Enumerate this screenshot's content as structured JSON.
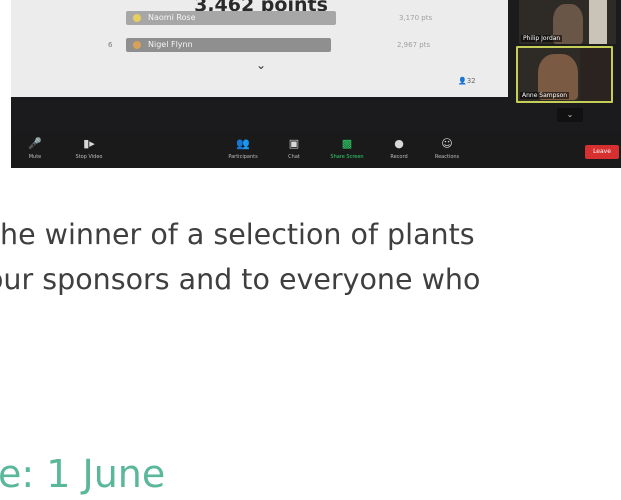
{
  "screenshot": {
    "leaderboard": {
      "points_label": "3,462 points",
      "rows": [
        {
          "name": "Naomi Rose",
          "score": "3,170 pts"
        },
        {
          "rank": "6",
          "name": "Nigel Flynn",
          "score": "2,967 pts"
        }
      ],
      "participant_count": "32"
    },
    "video_tiles": [
      {
        "name": "Philip Jordan"
      },
      {
        "name": "Anne Sampson"
      }
    ],
    "toolbar": {
      "mute": "Mute",
      "stop_video": "Stop Video",
      "participants": "Participants",
      "chat": "Chat",
      "share_screen": "Share Screen",
      "record": "Record",
      "reactions": "Reactions",
      "leave": "Leave"
    }
  },
  "article": {
    "line1": "he winner of a selection of plants",
    "line2": "our sponsors and to everyone who",
    "heading": "e: 1 June"
  },
  "colors": {
    "heading": "#5ab79a",
    "body_text": "#3f3f3f",
    "share_screen_active": "#2fd46b",
    "leave_button": "#d73030",
    "active_speaker_border": "#c5cf58"
  }
}
